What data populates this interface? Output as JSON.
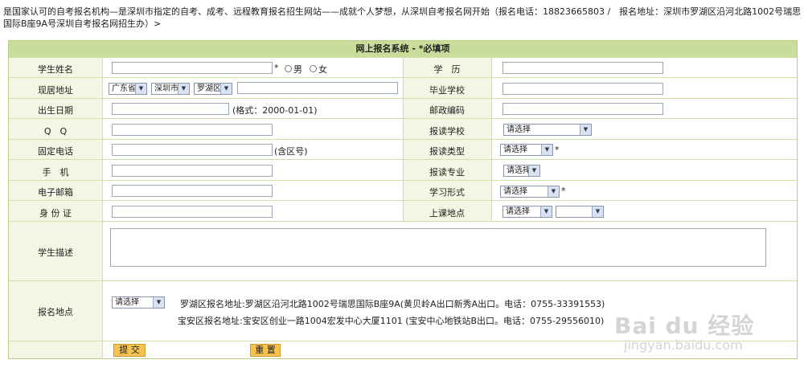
{
  "intro": "是国家认可的自考报名机构—是深圳市指定的自考、成考、远程教育报名招生网站——成就个人梦想，从深圳自考报名网开始（报名电话：18823665803 /　报名地址：深圳市罗湖区沿河北路1002号瑞思国际B座9A号深圳自考报名网招生办）>",
  "form_title": "网上报名系统 - *必填项",
  "labels": {
    "name": "学生姓名",
    "address": "现居地址",
    "birth": "出生日期",
    "qq": "Q　Q",
    "phone": "固定电话",
    "mobile": "手　机",
    "email": "电子邮箱",
    "idcard": "身 份 证",
    "education": "学　历",
    "school": "毕业学校",
    "postcode": "邮政编码",
    "apply_school": "报读学校",
    "apply_type": "报读类型",
    "apply_major": "报读专业",
    "study_form": "学习形式",
    "class_location": "上课地点",
    "description": "学生描述",
    "signup_location": "报名地点"
  },
  "required_mark": "*",
  "gender": {
    "male": "男",
    "female": "女"
  },
  "address_selects": {
    "province": "广东省",
    "city": "深圳市",
    "district": "罗湖区"
  },
  "hints": {
    "birth_format": "(格式：2000-01-01)",
    "phone_area": "(含区号)"
  },
  "select_default": "请选择",
  "locations": [
    "罗湖区报名地址:罗湖区沿河北路1002号瑞思国际B座9A(黄贝岭A出口新秀A出口。电话：0755-33391553)",
    "宝安区报名地址:宝安区创业一路1004宏发中心大厦1101 (宝安中心地铁站B出口。电话：0755-29556010)"
  ],
  "buttons": {
    "submit": "提 交",
    "reset": "重 置"
  },
  "watermark": {
    "brand": "Bai du 经验",
    "url": "jingyan.baidu.com"
  }
}
